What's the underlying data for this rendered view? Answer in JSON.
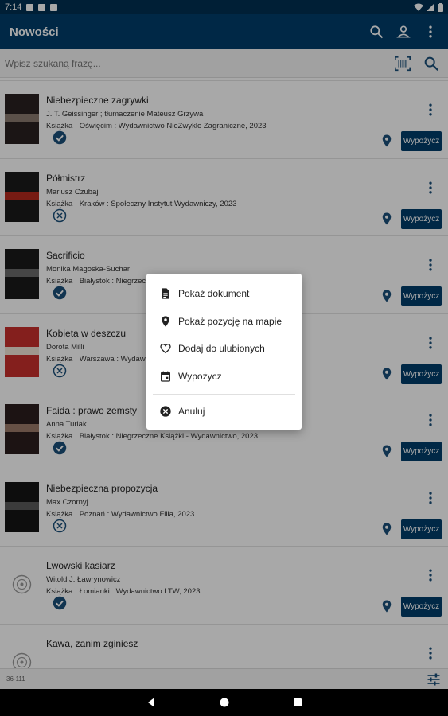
{
  "status_bar": {
    "time": "7:14"
  },
  "app_bar": {
    "title": "Nowości",
    "icons": [
      "search-icon",
      "account-icon",
      "more-vert-icon"
    ]
  },
  "search": {
    "placeholder": "Wpisz szukaną frazę..."
  },
  "items": [
    {
      "title": "Niebezpieczne zagrywki",
      "author": "J. T. Geissinger ; tłumaczenie Mateusz Grzywa",
      "details": "Książka · Oświęcim : Wydawnictwo NieZwykłe Zagraniczne, 2023",
      "available": true,
      "borrow": "Wypożycz",
      "cover_colors": [
        "#2a2020",
        "#8a7a70"
      ]
    },
    {
      "title": "Półmistrz",
      "author": "Mariusz Czubaj",
      "details": "Książka · Kraków : Społeczny Instytut Wydawniczy, 2023",
      "available": false,
      "borrow": "Wypożycz",
      "cover_colors": [
        "#1b1b1b",
        "#b52a1e"
      ]
    },
    {
      "title": "Sacrificio",
      "author": "Monika Magoska-Suchar",
      "details": "Książka · Białystok : Niegrzeczne Książki - Wydawnictwo, 2023",
      "available": true,
      "borrow": "Wypożycz",
      "cover_colors": [
        "#1a1a1a",
        "#6b6b6b"
      ]
    },
    {
      "title": "Kobieta w deszczu",
      "author": "Dorota Milli",
      "details": "Książka · Warszawa : Wydawnictwo Muza, 2023",
      "available": false,
      "borrow": "Wypożycz",
      "cover_colors": [
        "#c9302c",
        "#f2e6d8"
      ]
    },
    {
      "title": "Faida : prawo zemsty",
      "author": "Anna Turlak",
      "details": "Książka · Białystok : Niegrzeczne Książki - Wydawnictwo, 2023",
      "available": true,
      "borrow": "Wypożycz",
      "cover_colors": [
        "#2b1d1d",
        "#9c7a6a"
      ]
    },
    {
      "title": "Niebezpieczna propozycja",
      "author": "Max Czornyj",
      "details": "Książka · Poznań : Wydawnictwo Filia, 2023",
      "available": false,
      "borrow": "Wypożycz",
      "cover_colors": [
        "#141414",
        "#5a5a5a"
      ]
    },
    {
      "title": "Lwowski kasiarz",
      "author": "Witold J. Ławrynowicz",
      "details": "Książka · Łomianki : Wydawnictwo LTW, 2023",
      "available": true,
      "borrow": "Wypożycz",
      "cover_colors": null
    },
    {
      "title": "Kawa, zanim zginiesz",
      "author": "",
      "details": "",
      "available": null,
      "borrow": "",
      "cover_colors": null
    }
  ],
  "footer": {
    "range": "36-111"
  },
  "context_menu": {
    "items": [
      {
        "label": "Pokaż dokument",
        "icon": "document-icon"
      },
      {
        "label": "Pokaż pozycję na mapie",
        "icon": "map-pin-icon"
      },
      {
        "label": "Dodaj do ulubionych",
        "icon": "heart-icon"
      },
      {
        "label": "Wypożycz",
        "icon": "calendar-icon"
      }
    ],
    "cancel": {
      "label": "Anuluj",
      "icon": "cancel-icon"
    }
  },
  "colors": {
    "primary": "#003e6b",
    "status_bar": "#002f52",
    "icon": "#1a4f7a"
  }
}
